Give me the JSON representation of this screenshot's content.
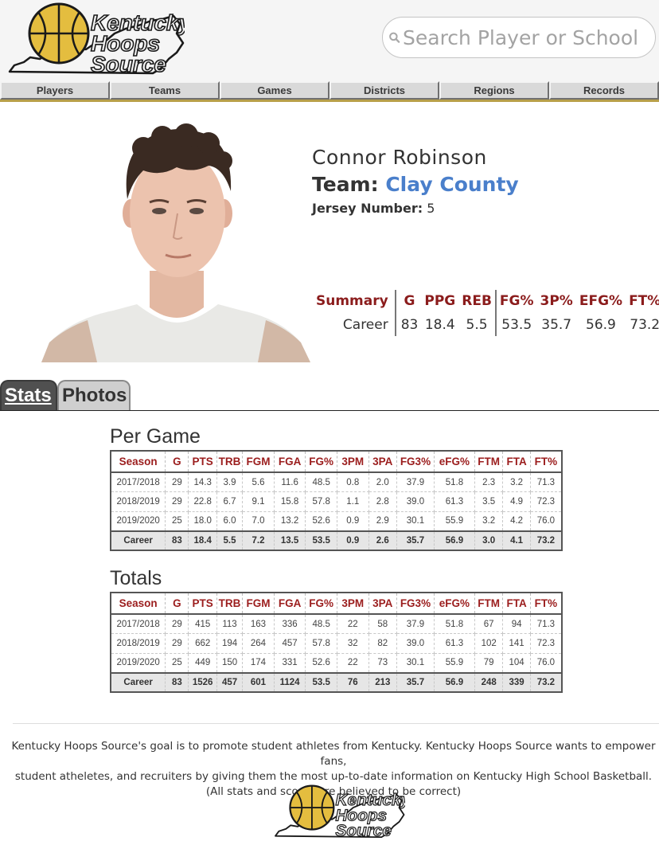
{
  "site": {
    "logo_text": [
      "Kentucky",
      "Hoops",
      "Source"
    ]
  },
  "search": {
    "placeholder": "Search Player or School"
  },
  "nav": [
    "Players",
    "Teams",
    "Games",
    "Districts",
    "Regions",
    "Records"
  ],
  "player": {
    "name": "Connor Robinson",
    "team_label": "Team:",
    "team": "Clay County",
    "jersey_label": "Jersey Number:",
    "jersey_number": "5"
  },
  "summary": {
    "headers": [
      "Summary",
      "G",
      "PPG",
      "REB",
      "FG%",
      "3P%",
      "EFG%",
      "FT%"
    ],
    "row": [
      "Career",
      "83",
      "18.4",
      "5.5",
      "53.5",
      "35.7",
      "56.9",
      "73.2"
    ]
  },
  "tabs": [
    "Stats",
    "Photos"
  ],
  "per_game": {
    "title": "Per Game",
    "headers": [
      "Season",
      "G",
      "PTS",
      "TRB",
      "FGM",
      "FGA",
      "FG%",
      "3PM",
      "3PA",
      "FG3%",
      "eFG%",
      "FTM",
      "FTA",
      "FT%"
    ],
    "rows": [
      [
        "2017/2018",
        "29",
        "14.3",
        "3.9",
        "5.6",
        "11.6",
        "48.5",
        "0.8",
        "2.0",
        "37.9",
        "51.8",
        "2.3",
        "3.2",
        "71.3"
      ],
      [
        "2018/2019",
        "29",
        "22.8",
        "6.7",
        "9.1",
        "15.8",
        "57.8",
        "1.1",
        "2.8",
        "39.0",
        "61.3",
        "3.5",
        "4.9",
        "72.3"
      ],
      [
        "2019/2020",
        "25",
        "18.0",
        "6.0",
        "7.0",
        "13.2",
        "52.6",
        "0.9",
        "2.9",
        "30.1",
        "55.9",
        "3.2",
        "4.2",
        "76.0"
      ]
    ],
    "career": [
      "Career",
      "83",
      "18.4",
      "5.5",
      "7.2",
      "13.5",
      "53.5",
      "0.9",
      "2.6",
      "35.7",
      "56.9",
      "3.0",
      "4.1",
      "73.2"
    ]
  },
  "totals": {
    "title": "Totals",
    "headers": [
      "Season",
      "G",
      "PTS",
      "TRB",
      "FGM",
      "FGA",
      "FG%",
      "3PM",
      "3PA",
      "FG3%",
      "eFG%",
      "FTM",
      "FTA",
      "FT%"
    ],
    "rows": [
      [
        "2017/2018",
        "29",
        "415",
        "113",
        "163",
        "336",
        "48.5",
        "22",
        "58",
        "37.9",
        "51.8",
        "67",
        "94",
        "71.3"
      ],
      [
        "2018/2019",
        "29",
        "662",
        "194",
        "264",
        "457",
        "57.8",
        "32",
        "82",
        "39.0",
        "61.3",
        "102",
        "141",
        "72.3"
      ],
      [
        "2019/2020",
        "25",
        "449",
        "150",
        "174",
        "331",
        "52.6",
        "22",
        "73",
        "30.1",
        "55.9",
        "79",
        "104",
        "76.0"
      ]
    ],
    "career": [
      "Career",
      "83",
      "1526",
      "457",
      "601",
      "1124",
      "53.5",
      "76",
      "213",
      "35.7",
      "56.9",
      "248",
      "339",
      "73.2"
    ]
  },
  "footer": {
    "line1": "Kentucky Hoops Source's goal is to promote student athletes from Kentucky. Kentucky Hoops Source wants to empower fans,",
    "line2": "student atheletes, and recruiters by giving them the most up-to-date information on Kentucky High School Basketball.",
    "line3": "(All stats and scores are believed to be correct)"
  },
  "colors": {
    "accent_red": "#9b1d1d",
    "link_blue": "#4a7fcb",
    "ball_gold": "#e4bd3f",
    "nav_gold": "#b8a04a"
  },
  "icons": [
    "search-icon",
    "basketball-icon",
    "kentucky-state-outline-icon"
  ]
}
